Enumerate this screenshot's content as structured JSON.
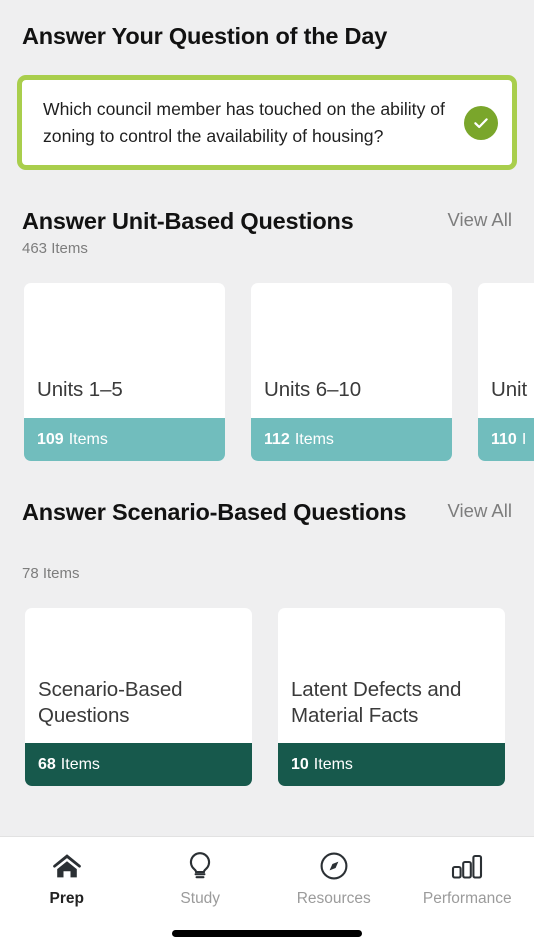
{
  "theme": {
    "background": "#efeff0",
    "card_white": "#ffffff",
    "accent_lime": "#a9ce4c",
    "accent_green_badge": "#7aa62b",
    "accent_teal": "#71bdbd",
    "accent_dark_green": "#17594c",
    "muted_text": "#7d7d7d",
    "heading_text": "#121212"
  },
  "question_of_the_day": {
    "title": "Answer Your Question of the Day",
    "question": "Which council member has touched on the ability of zoning to control the availability of housing?",
    "status_icon": "check-circle-icon"
  },
  "unit_based": {
    "title": "Answer Unit-Based Questions",
    "view_all_label": "View All",
    "subtitle": "463 Items",
    "cards": [
      {
        "title": "Units 1–5",
        "count": "109",
        "count_unit": "Items"
      },
      {
        "title": "Units 6–10",
        "count": "112",
        "count_unit": "Items"
      },
      {
        "title": "Unit",
        "count": "110",
        "count_unit": "I"
      }
    ]
  },
  "scenario_based": {
    "title": "Answer Scenario-Based Questions",
    "view_all_label": "View All",
    "subtitle": "78 Items",
    "cards": [
      {
        "title": "Scenario-Based Questions",
        "count": "68",
        "count_unit": "Items"
      },
      {
        "title": "Latent Defects and Material Facts",
        "count": "10",
        "count_unit": "Items"
      }
    ]
  },
  "tabbar": {
    "items": [
      {
        "label": "Prep",
        "icon": "home-icon",
        "active": true
      },
      {
        "label": "Study",
        "icon": "lightbulb-icon",
        "active": false
      },
      {
        "label": "Resources",
        "icon": "compass-icon",
        "active": false
      },
      {
        "label": "Performance",
        "icon": "bar-chart-icon",
        "active": false
      }
    ]
  }
}
